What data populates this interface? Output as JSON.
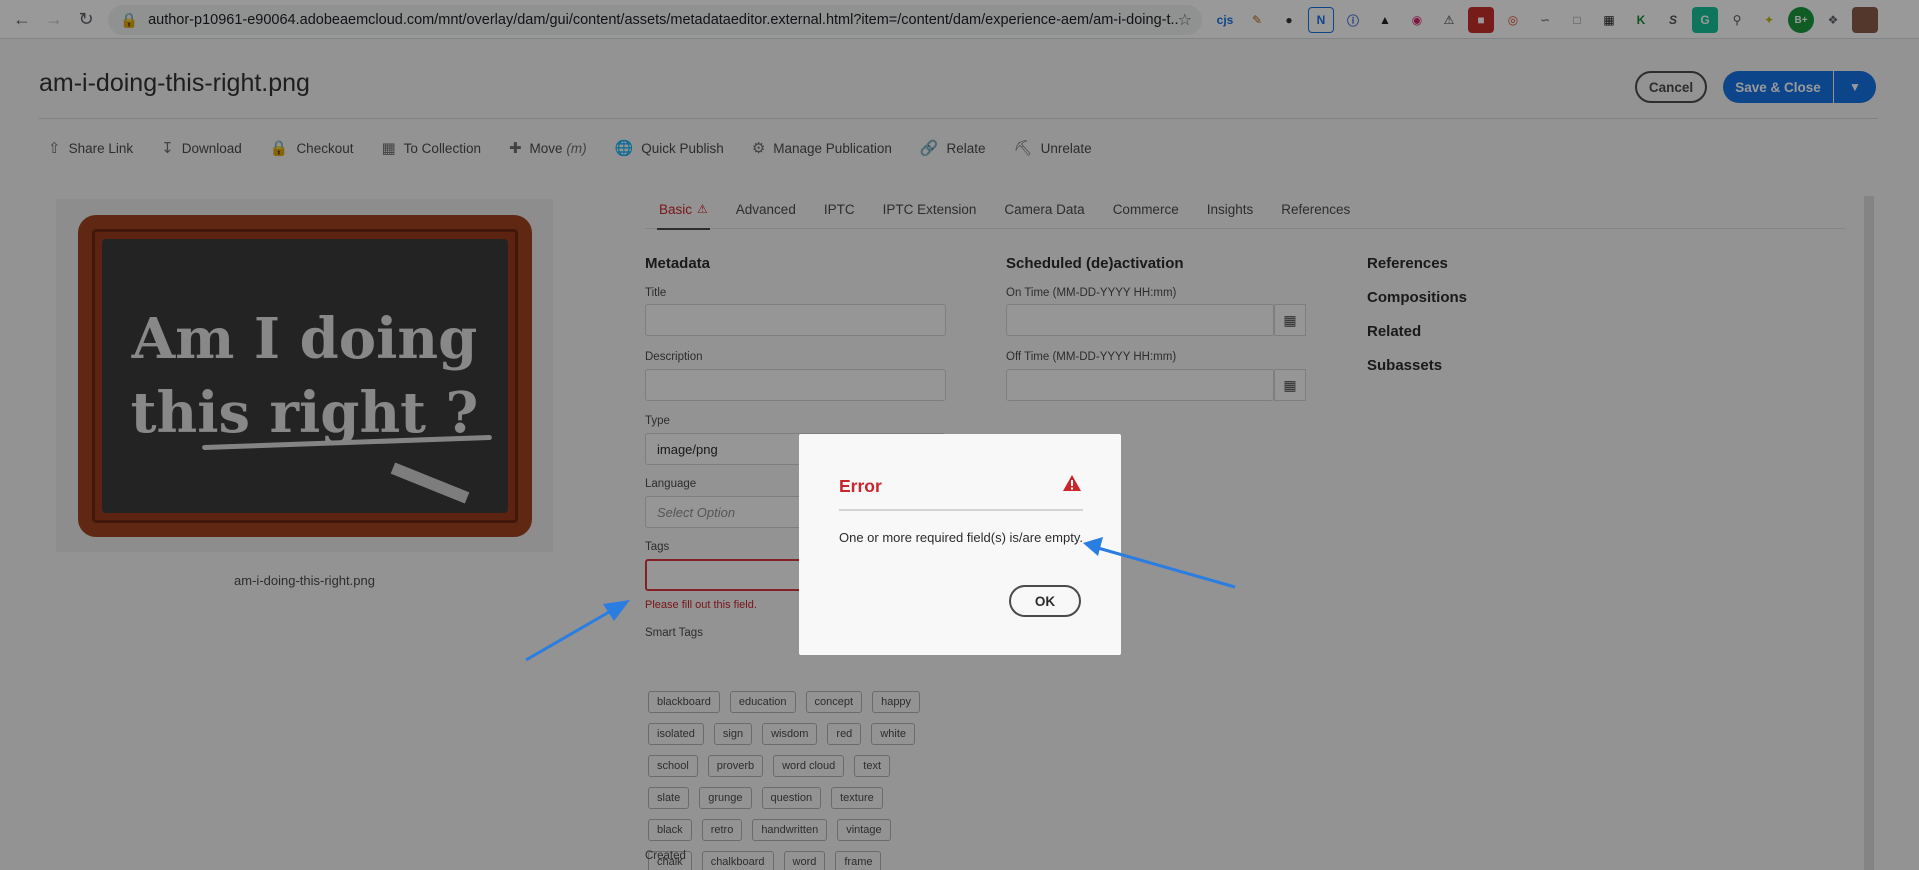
{
  "browser": {
    "url": "author-p10961-e90064.adobeaemcloud.com/mnt/overlay/dam/gui/content/assets/metadataeditor.external.html?item=/content/dam/experience-aem/am-i-doing-t...",
    "extensions": [
      "cjs",
      "pen",
      "circle",
      "N",
      "info",
      "ninja",
      "target",
      "warning",
      "pdf",
      "rec",
      "fig",
      "box",
      "calendar",
      "K",
      "S",
      "G",
      "search",
      "pin",
      "B+",
      "puzzle",
      "avatar"
    ]
  },
  "header": {
    "title": "am-i-doing-this-right.png",
    "cancel_label": "Cancel",
    "save_label": "Save & Close"
  },
  "toolbar": {
    "items": [
      {
        "label": "Share Link",
        "icon": "share-icon"
      },
      {
        "label": "Download",
        "icon": "download-icon"
      },
      {
        "label": "Checkout",
        "icon": "lock-icon"
      },
      {
        "label": "To Collection",
        "icon": "collection-icon"
      },
      {
        "label": "Move",
        "shortcut": "(m)",
        "icon": "plus-icon"
      },
      {
        "label": "Quick Publish",
        "icon": "globe-icon"
      },
      {
        "label": "Manage Publication",
        "icon": "globe-gear-icon"
      },
      {
        "label": "Relate",
        "icon": "link-icon"
      },
      {
        "label": "Unrelate",
        "icon": "unlink-icon"
      }
    ]
  },
  "preview": {
    "image_text_line1": "Am I doing",
    "image_text_line2": "this right ?",
    "caption": "am-i-doing-this-right.png"
  },
  "tabs": [
    "Basic",
    "Advanced",
    "IPTC",
    "IPTC Extension",
    "Camera Data",
    "Commerce",
    "Insights",
    "References"
  ],
  "metadata": {
    "heading": "Metadata",
    "title_label": "Title",
    "title_value": "",
    "description_label": "Description",
    "description_value": "",
    "type_label": "Type",
    "type_value": "image/png",
    "language_label": "Language",
    "language_placeholder": "Select Option",
    "tags_label": "Tags",
    "tags_error": "Please fill out this field.",
    "smart_tags_label": "Smart Tags",
    "smart_tags": [
      [
        "blackboard",
        "education",
        "concept",
        "happy"
      ],
      [
        "isolated",
        "sign",
        "wisdom",
        "red",
        "white"
      ],
      [
        "school",
        "proverb",
        "word cloud",
        "text"
      ],
      [
        "slate",
        "grunge",
        "question",
        "texture"
      ],
      [
        "black",
        "retro",
        "handwritten",
        "vintage"
      ],
      [
        "chalk",
        "chalkboard",
        "word",
        "frame"
      ]
    ],
    "created_label": "Created"
  },
  "schedule": {
    "heading": "Scheduled (de)activation",
    "on_time_label": "On Time (MM-DD-YYYY HH:mm)",
    "off_time_label": "Off Time (MM-DD-YYYY HH:mm)"
  },
  "side_links": [
    "References",
    "Compositions",
    "Related",
    "Subassets"
  ],
  "dialog": {
    "title": "Error",
    "message": "One or more required field(s) is/are empty.",
    "ok_label": "OK"
  },
  "colors": {
    "accent": "#1473e6",
    "error": "#c9252d",
    "annotation_arrow": "#2a7de1"
  }
}
